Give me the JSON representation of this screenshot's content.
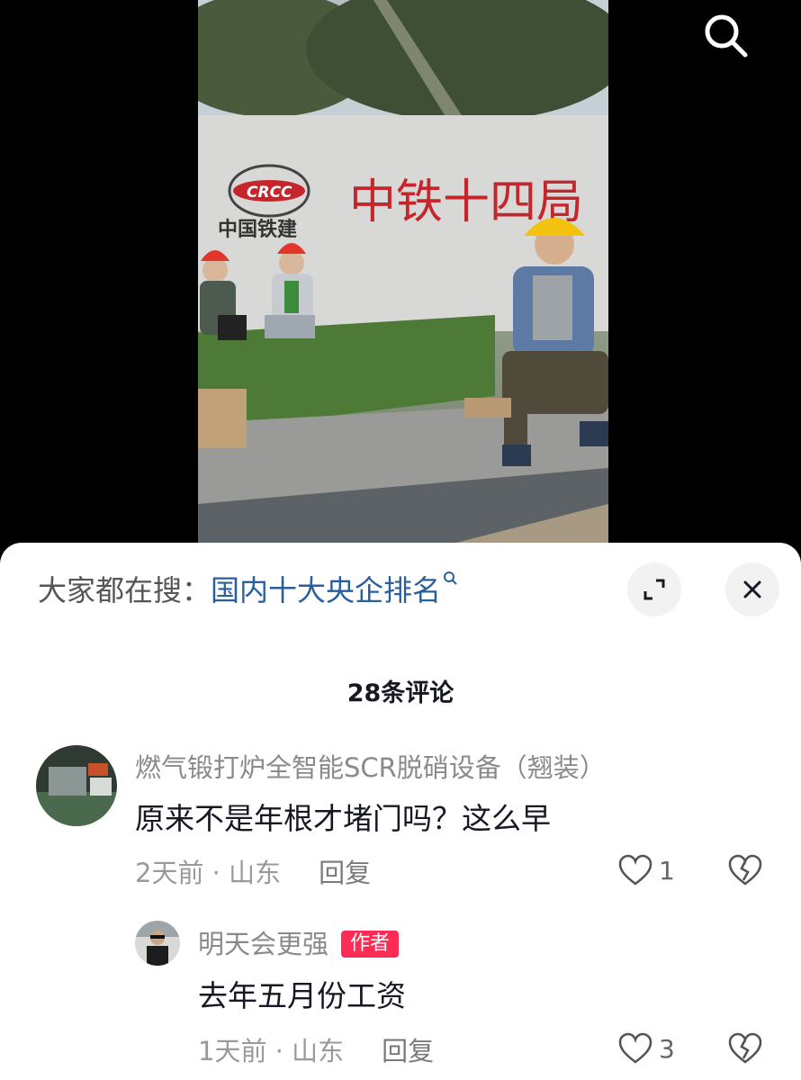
{
  "video": {
    "sign_logo_text": "CRCC",
    "sign_company": "中国铁建",
    "sign_big_text": "中铁十四局"
  },
  "hot_search": {
    "prefix": "大家都在搜：",
    "query": "国内十大央企排名"
  },
  "comments_header": {
    "count_label": "28条评论"
  },
  "comments": [
    {
      "username": "燃气锻打炉全智能SCR脱硝设备（翘装）",
      "text": "原来不是年根才堵门吗？这么早",
      "meta": "2天前 · 山东",
      "reply_label": "回复",
      "likes": "1"
    },
    {
      "username": "明天会更强",
      "badge": "作者",
      "text": "去年五月份工资",
      "meta": "1天前 · 山东",
      "reply_label": "回复",
      "likes": "3"
    }
  ],
  "icons": {
    "search": "search-icon",
    "expand": "expand-icon",
    "close": "close-icon",
    "heart": "heart-icon",
    "broken_heart": "broken-heart-icon"
  },
  "colors": {
    "accent_link": "#2a5f9e",
    "author_badge": "#fe2c55",
    "sign_red": "#c4262c"
  }
}
